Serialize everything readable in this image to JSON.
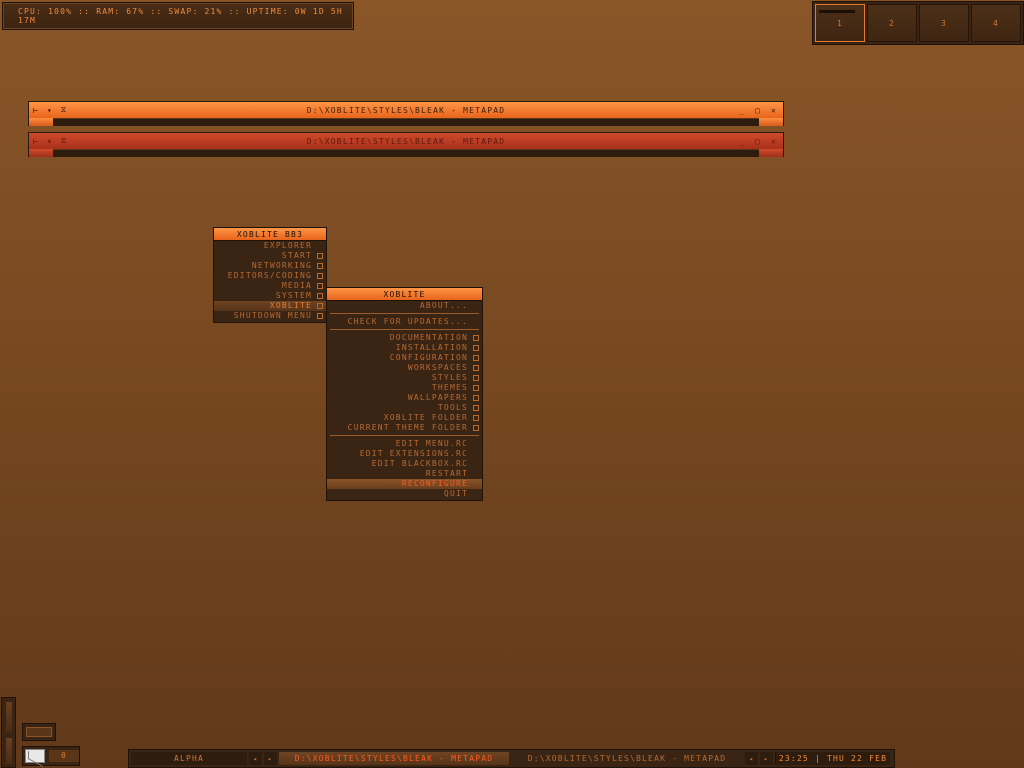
{
  "system_monitor": {
    "text": "CPU: 100% :: RAM: 67% :: SWAP: 21% :: UPTIME: 0W 1D 5H 17M"
  },
  "pager": {
    "workspaces": [
      "1",
      "2",
      "3",
      "4"
    ],
    "active": "1"
  },
  "windows": [
    {
      "title": "D:\\XOBLITE\\STYLES\\BLEAK - METAPAD",
      "state": "focused"
    },
    {
      "title": "D:\\XOBLITE\\STYLES\\BLEAK - METAPAD",
      "state": "unfocused"
    }
  ],
  "window_buttons": {
    "left": [
      "⊢",
      "▾",
      "⧖"
    ],
    "right": [
      "_",
      "▢",
      "✕"
    ]
  },
  "main_menu": {
    "title": "XOBLITE BB3",
    "items": [
      "EXPLORER",
      "START",
      "NETWORKING",
      "EDITORS/CODING",
      "MEDIA",
      "SYSTEM",
      "XOBLITE",
      "SHUTDOWN MENU"
    ]
  },
  "xoblite_menu": {
    "title": "XOBLITE",
    "about": "ABOUT...",
    "check_updates": "CHECK FOR UPDATES...",
    "folders": [
      "DOCUMENTATION",
      "INSTALLATION",
      "CONFIGURATION",
      "WORKSPACES",
      "STYLES",
      "THEMES",
      "WALLPAPERS",
      "TOOLS",
      "XOBLITE FOLDER",
      "CURRENT THEME FOLDER"
    ],
    "actions": [
      "EDIT MENU.RC",
      "EDIT EXTENSIONS.RC",
      "EDIT BLACKBOX.RC",
      "RESTART",
      "RECONFIGURE",
      "QUIT"
    ],
    "highlighted": "RECONFIGURE"
  },
  "mail": {
    "count": "0"
  },
  "taskbar": {
    "workspace_name": "ALPHA",
    "tasks": [
      "D:\\XOBLITE\\STYLES\\BLEAK - METAPAD",
      "D:\\XOBLITE\\STYLES\\BLEAK - METAPAD"
    ],
    "clock": "23:25 | THU 22 FEB",
    "arrow_left": "◂",
    "arrow_right": "▸"
  },
  "colors": {
    "accent": "#e8641c",
    "active_text": "#ff5a1e",
    "background": "#7a4a22",
    "panel": "#3a2414"
  }
}
